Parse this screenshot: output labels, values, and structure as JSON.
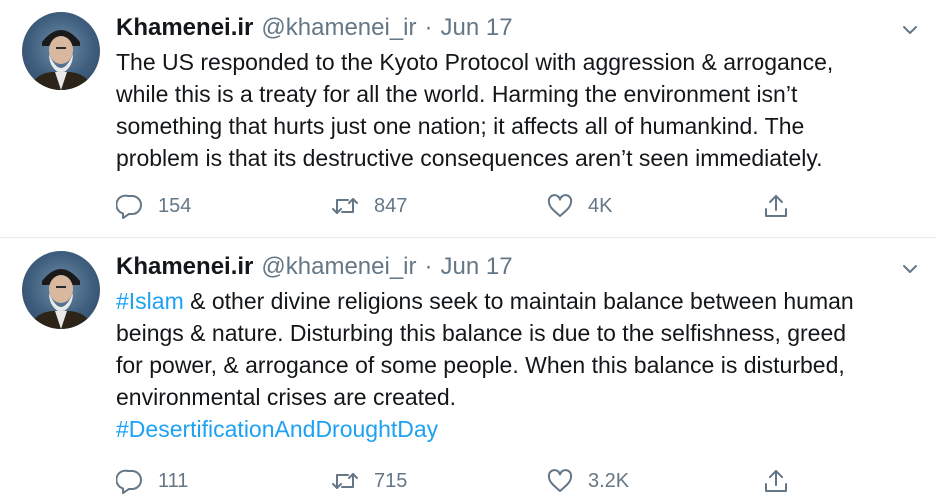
{
  "tweets": [
    {
      "author_name": "Khamenei.ir",
      "handle": "@khamenei_ir",
      "separator": "·",
      "date": "Jun 17",
      "text_lines": [
        "The US responded to the Kyoto Protocol with aggression & arrogance,",
        "while this is a treaty for all the world. Harming the environment isn’t",
        "something that hurts just one nation; it affects all of humankind. The",
        "problem is that its destructive consequences aren’t seen immediately."
      ],
      "replies": "154",
      "retweets": "847",
      "likes": "4K"
    },
    {
      "author_name": "Khamenei.ir",
      "handle": "@khamenei_ir",
      "separator": "·",
      "date": "Jun 17",
      "hashtag_start": "#Islam",
      "text_first_rest": " & other divine religions seek to maintain balance between human",
      "text_lines": [
        "beings & nature. Disturbing this balance is due to the selfishness, greed",
        "for power, & arrogance of some people. When this balance is disturbed,",
        "environmental crises are created."
      ],
      "hashtag_end": "#DesertificationAndDroughtDay",
      "replies": "111",
      "retweets": "715",
      "likes": "3.2K"
    }
  ],
  "icons": {
    "reply": "speech-bubble",
    "retweet": "retweet-arrows",
    "like": "heart-outline",
    "share": "share-upload",
    "caret": "chevron-down"
  },
  "colors": {
    "text": "#14171a",
    "secondary": "#657786",
    "hashtag": "#1da1f2",
    "divider": "#e6ecf0"
  }
}
